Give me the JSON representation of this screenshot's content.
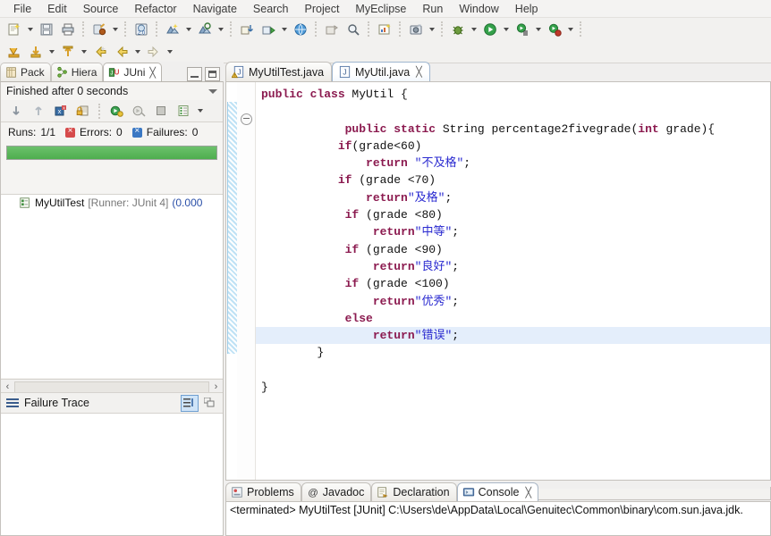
{
  "menubar": {
    "items": [
      {
        "label": "File"
      },
      {
        "label": "Edit"
      },
      {
        "label": "Source"
      },
      {
        "label": "Refactor"
      },
      {
        "label": "Navigate"
      },
      {
        "label": "Search"
      },
      {
        "label": "Project"
      },
      {
        "label": "MyEclipse"
      },
      {
        "label": "Run"
      },
      {
        "label": "Window"
      },
      {
        "label": "Help"
      }
    ]
  },
  "toolbar": {
    "row1": [
      {
        "icon": "new-wizard-icon",
        "dropdown": true
      },
      {
        "icon": "save-icon",
        "dropdown": false
      },
      {
        "icon": "print-icon",
        "dropdown": false
      },
      {
        "sep": true
      },
      {
        "icon": "deploy-myeclipse-icon",
        "dropdown": true
      },
      {
        "sep": true
      },
      {
        "icon": "web-browser-20-icon",
        "dropdown": false
      },
      {
        "sep": true
      },
      {
        "icon": "new-java-project-icon",
        "dropdown": true
      },
      {
        "icon": "open-type-icon",
        "dropdown": true
      },
      {
        "sep": true
      },
      {
        "icon": "import-icon",
        "dropdown": false
      },
      {
        "icon": "export-icon",
        "dropdown": true
      },
      {
        "icon": "globe-icon",
        "dropdown": false
      },
      {
        "sep": true
      },
      {
        "icon": "open-perspective-icon",
        "dropdown": false
      },
      {
        "icon": "search-icon",
        "dropdown": false
      },
      {
        "sep": true
      },
      {
        "icon": "new-chart-icon",
        "dropdown": false
      },
      {
        "sep": true
      },
      {
        "icon": "snapshot-icon",
        "dropdown": true
      },
      {
        "sep": true
      },
      {
        "icon": "debug-icon",
        "dropdown": true
      },
      {
        "icon": "run-icon",
        "dropdown": true
      },
      {
        "icon": "external-tools-icon",
        "dropdown": true
      },
      {
        "icon": "run-last-icon",
        "dropdown": true
      },
      {
        "sep": true
      }
    ],
    "row2": [
      {
        "icon": "save-all-icon",
        "dropdown": false
      },
      {
        "icon": "download-icon",
        "dropdown": true
      },
      {
        "icon": "upload-icon",
        "dropdown": true
      },
      {
        "icon": "back-history-icon",
        "dropdown": false
      },
      {
        "icon": "back-arrow-icon",
        "dropdown": true
      },
      {
        "icon": "forward-arrow-icon",
        "dropdown": true
      }
    ]
  },
  "junit_view": {
    "tabs": [
      {
        "label": "Pack",
        "icon": "package-explorer-icon",
        "active": false,
        "closeable": false
      },
      {
        "label": "Hiera",
        "icon": "hierarchy-icon",
        "active": false,
        "closeable": false
      },
      {
        "label": "JUni",
        "icon": "junit-icon",
        "active": true,
        "closeable": true
      }
    ],
    "close_glyph": "╳",
    "status": "Finished after 0 seconds",
    "toolbar_icons": [
      "next-failure-icon",
      "previous-failure-icon",
      "show-failures-only-icon",
      "lock-scroll-icon",
      "rerun-test-icon",
      "rerun-failed-icon",
      "stop-icon",
      "test-history-icon"
    ],
    "counters": {
      "runs_label": "Runs:",
      "runs_value": "1/1",
      "errors_label": "Errors:",
      "errors_value": "0",
      "failures_label": "Failures:",
      "failures_value": "0"
    },
    "progress": {
      "percent": 100,
      "color": "#4eae4e"
    },
    "tree": [
      {
        "icon": "test-class-icon",
        "name": "MyUtilTest",
        "runner": "[Runner: JUnit 4]",
        "time": "(0.000"
      }
    ],
    "failure_trace": {
      "label": "Failure Trace",
      "buttons": [
        "filter-stack-trace-icon",
        "copy-trace-icon"
      ],
      "content": ""
    }
  },
  "editor": {
    "tabs": [
      {
        "label": "MyUtilTest.java",
        "icon": "java-file-warning-icon",
        "active": false,
        "closeable": false
      },
      {
        "label": "MyUtil.java",
        "icon": "java-file-icon",
        "active": true,
        "closeable": true
      }
    ],
    "close_glyph": "╳",
    "code_lines": [
      {
        "indent": 0,
        "highlight": false,
        "tokens": [
          {
            "t": "kw",
            "s": "public class"
          },
          {
            "t": "pl",
            "s": " MyUtil {"
          }
        ]
      },
      {
        "indent": 0,
        "highlight": false,
        "tokens": []
      },
      {
        "indent": 0,
        "highlight": false,
        "tokens": [
          {
            "t": "pl",
            "s": "            "
          },
          {
            "t": "kw",
            "s": "public static"
          },
          {
            "t": "pl",
            "s": " String percentage2fivegrade("
          },
          {
            "t": "kw",
            "s": "int"
          },
          {
            "t": "pl",
            "s": " grade){"
          }
        ]
      },
      {
        "indent": 0,
        "highlight": false,
        "tokens": [
          {
            "t": "pl",
            "s": "           "
          },
          {
            "t": "kw",
            "s": "if"
          },
          {
            "t": "pl",
            "s": "(grade<60)"
          }
        ]
      },
      {
        "indent": 0,
        "highlight": false,
        "tokens": [
          {
            "t": "pl",
            "s": "               "
          },
          {
            "t": "kw",
            "s": "return"
          },
          {
            "t": "pl",
            "s": " "
          },
          {
            "t": "str",
            "s": "\"不及格\""
          },
          {
            "t": "pl",
            "s": ";"
          }
        ]
      },
      {
        "indent": 0,
        "highlight": false,
        "tokens": [
          {
            "t": "pl",
            "s": "           "
          },
          {
            "t": "kw",
            "s": "if"
          },
          {
            "t": "pl",
            "s": " (grade <70)"
          }
        ]
      },
      {
        "indent": 0,
        "highlight": false,
        "tokens": [
          {
            "t": "pl",
            "s": "               "
          },
          {
            "t": "kw",
            "s": "return"
          },
          {
            "t": "str",
            "s": "\"及格\""
          },
          {
            "t": "pl",
            "s": ";"
          }
        ]
      },
      {
        "indent": 0,
        "highlight": false,
        "tokens": [
          {
            "t": "pl",
            "s": "            "
          },
          {
            "t": "kw",
            "s": "if"
          },
          {
            "t": "pl",
            "s": " (grade <80)"
          }
        ]
      },
      {
        "indent": 0,
        "highlight": false,
        "tokens": [
          {
            "t": "pl",
            "s": "                "
          },
          {
            "t": "kw",
            "s": "return"
          },
          {
            "t": "str",
            "s": "\"中等\""
          },
          {
            "t": "pl",
            "s": ";"
          }
        ]
      },
      {
        "indent": 0,
        "highlight": false,
        "tokens": [
          {
            "t": "pl",
            "s": "            "
          },
          {
            "t": "kw",
            "s": "if"
          },
          {
            "t": "pl",
            "s": " (grade <90)"
          }
        ]
      },
      {
        "indent": 0,
        "highlight": false,
        "tokens": [
          {
            "t": "pl",
            "s": "                "
          },
          {
            "t": "kw",
            "s": "return"
          },
          {
            "t": "str",
            "s": "\"良好\""
          },
          {
            "t": "pl",
            "s": ";"
          }
        ]
      },
      {
        "indent": 0,
        "highlight": false,
        "tokens": [
          {
            "t": "pl",
            "s": "            "
          },
          {
            "t": "kw",
            "s": "if"
          },
          {
            "t": "pl",
            "s": " (grade <100)"
          }
        ]
      },
      {
        "indent": 0,
        "highlight": false,
        "tokens": [
          {
            "t": "pl",
            "s": "                "
          },
          {
            "t": "kw",
            "s": "return"
          },
          {
            "t": "str",
            "s": "\"优秀\""
          },
          {
            "t": "pl",
            "s": ";"
          }
        ]
      },
      {
        "indent": 0,
        "highlight": false,
        "tokens": [
          {
            "t": "pl",
            "s": "            "
          },
          {
            "t": "kw",
            "s": "else"
          }
        ]
      },
      {
        "indent": 0,
        "highlight": true,
        "tokens": [
          {
            "t": "pl",
            "s": "                "
          },
          {
            "t": "kw",
            "s": "return"
          },
          {
            "t": "str",
            "s": "\"错误\""
          },
          {
            "t": "pl",
            "s": ";"
          }
        ]
      },
      {
        "indent": 0,
        "highlight": false,
        "tokens": [
          {
            "t": "pl",
            "s": "        }"
          }
        ]
      },
      {
        "indent": 0,
        "highlight": false,
        "tokens": []
      },
      {
        "indent": 0,
        "highlight": false,
        "tokens": [
          {
            "t": "pl",
            "s": "}"
          }
        ]
      }
    ],
    "scroll_left_glyph": "‹"
  },
  "bottom": {
    "tabs": [
      {
        "label": "Problems",
        "icon": "problems-icon",
        "active": false,
        "closeable": false
      },
      {
        "label": "Javadoc",
        "icon": "javadoc-at-icon",
        "active": false,
        "closeable": false
      },
      {
        "label": "Declaration",
        "icon": "declaration-icon",
        "active": false,
        "closeable": false
      },
      {
        "label": "Console",
        "icon": "console-icon",
        "active": true,
        "closeable": true
      }
    ],
    "close_glyph": "╳",
    "console_text": "<terminated> MyUtilTest [JUnit] C:\\Users\\de\\AppData\\Local\\Genuitec\\Common\\binary\\com.sun.java.jdk."
  },
  "colors": {
    "keyword": "#8b1a4f",
    "string": "#2a2ad0",
    "progress_green": "#4eae4e",
    "highlight_line": "#e4eefb",
    "chrome": "#f0efee"
  }
}
